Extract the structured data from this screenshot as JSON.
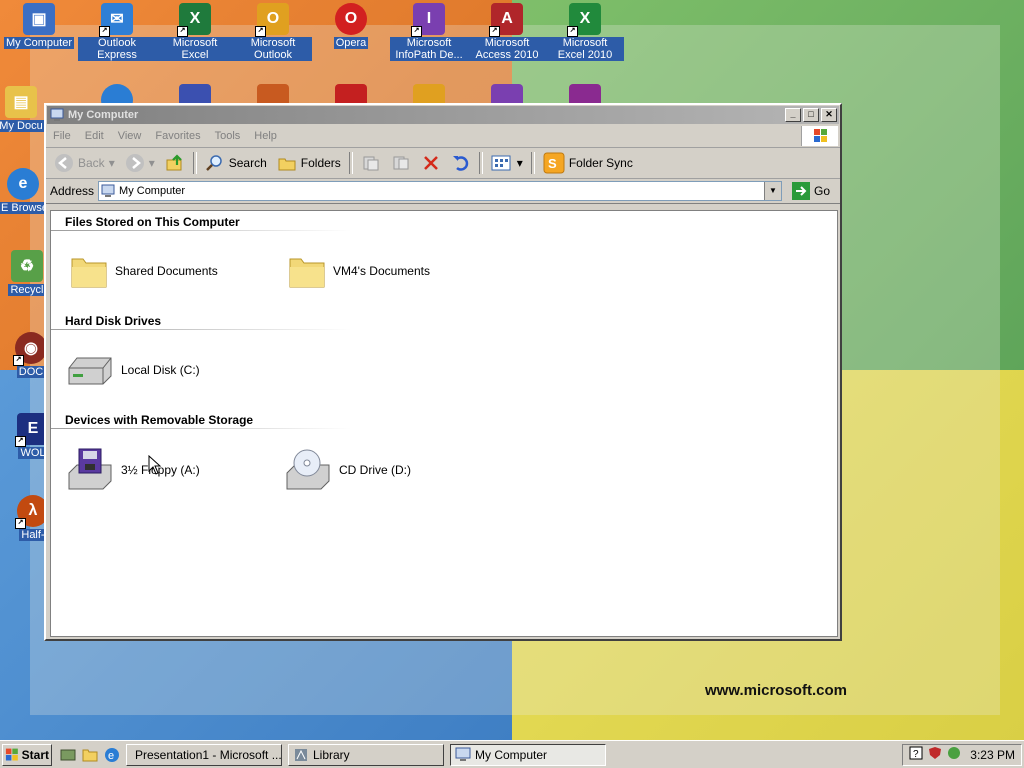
{
  "desktop": {
    "icons": [
      {
        "label": "My Computer",
        "color": "#3b6fc4",
        "glyph": "▣"
      },
      {
        "label": "Outlook Express",
        "color": "#2f7fd6",
        "glyph": "✉"
      },
      {
        "label": "Microsoft Excel",
        "color": "#1f7a3c",
        "glyph": "X"
      },
      {
        "label": "Microsoft Outlook",
        "color": "#e0a020",
        "glyph": "O"
      },
      {
        "label": "Opera",
        "color": "#d22020",
        "glyph": "O"
      },
      {
        "label": "Microsoft InfoPath De...",
        "color": "#7a3fb0",
        "glyph": "I"
      },
      {
        "label": "Microsoft Access 2010",
        "color": "#b0262a",
        "glyph": "A"
      },
      {
        "label": "Microsoft Excel 2010",
        "color": "#218a3c",
        "glyph": "X"
      },
      {
        "label": "My Docu",
        "color": "#e8c24a",
        "glyph": "▤"
      },
      {
        "label": "IE Browse",
        "color": "#2a7dd4",
        "glyph": "e"
      },
      {
        "label": "Recycl",
        "color": "#58a048",
        "glyph": "♻"
      },
      {
        "label": "DOC",
        "color": "#8a2a20",
        "glyph": "◉"
      },
      {
        "label": "WOL",
        "color": "#1c2f80",
        "glyph": "E"
      },
      {
        "label": "Half-",
        "color": "#c24a10",
        "glyph": "λ"
      }
    ],
    "brand_text": "www.microsoft.com"
  },
  "window": {
    "title": "My Computer",
    "menu": [
      "File",
      "Edit",
      "View",
      "Favorites",
      "Tools",
      "Help"
    ],
    "toolbar": {
      "back": "Back",
      "search": "Search",
      "folders": "Folders",
      "folder_sync": "Folder Sync"
    },
    "address": {
      "label": "Address",
      "value": "My Computer",
      "go": "Go"
    },
    "groups": [
      {
        "title": "Files Stored on This Computer",
        "items": [
          "Shared Documents",
          "VM4's Documents"
        ]
      },
      {
        "title": "Hard Disk Drives",
        "items": [
          "Local Disk (C:)"
        ]
      },
      {
        "title": "Devices with Removable Storage",
        "items": [
          "3½ Floppy (A:)",
          "CD Drive (D:)"
        ]
      }
    ]
  },
  "taskbar": {
    "start": "Start",
    "tasks": [
      "Presentation1 - Microsoft ...",
      "Library",
      "My Computer"
    ],
    "clock": "3:23 PM"
  }
}
